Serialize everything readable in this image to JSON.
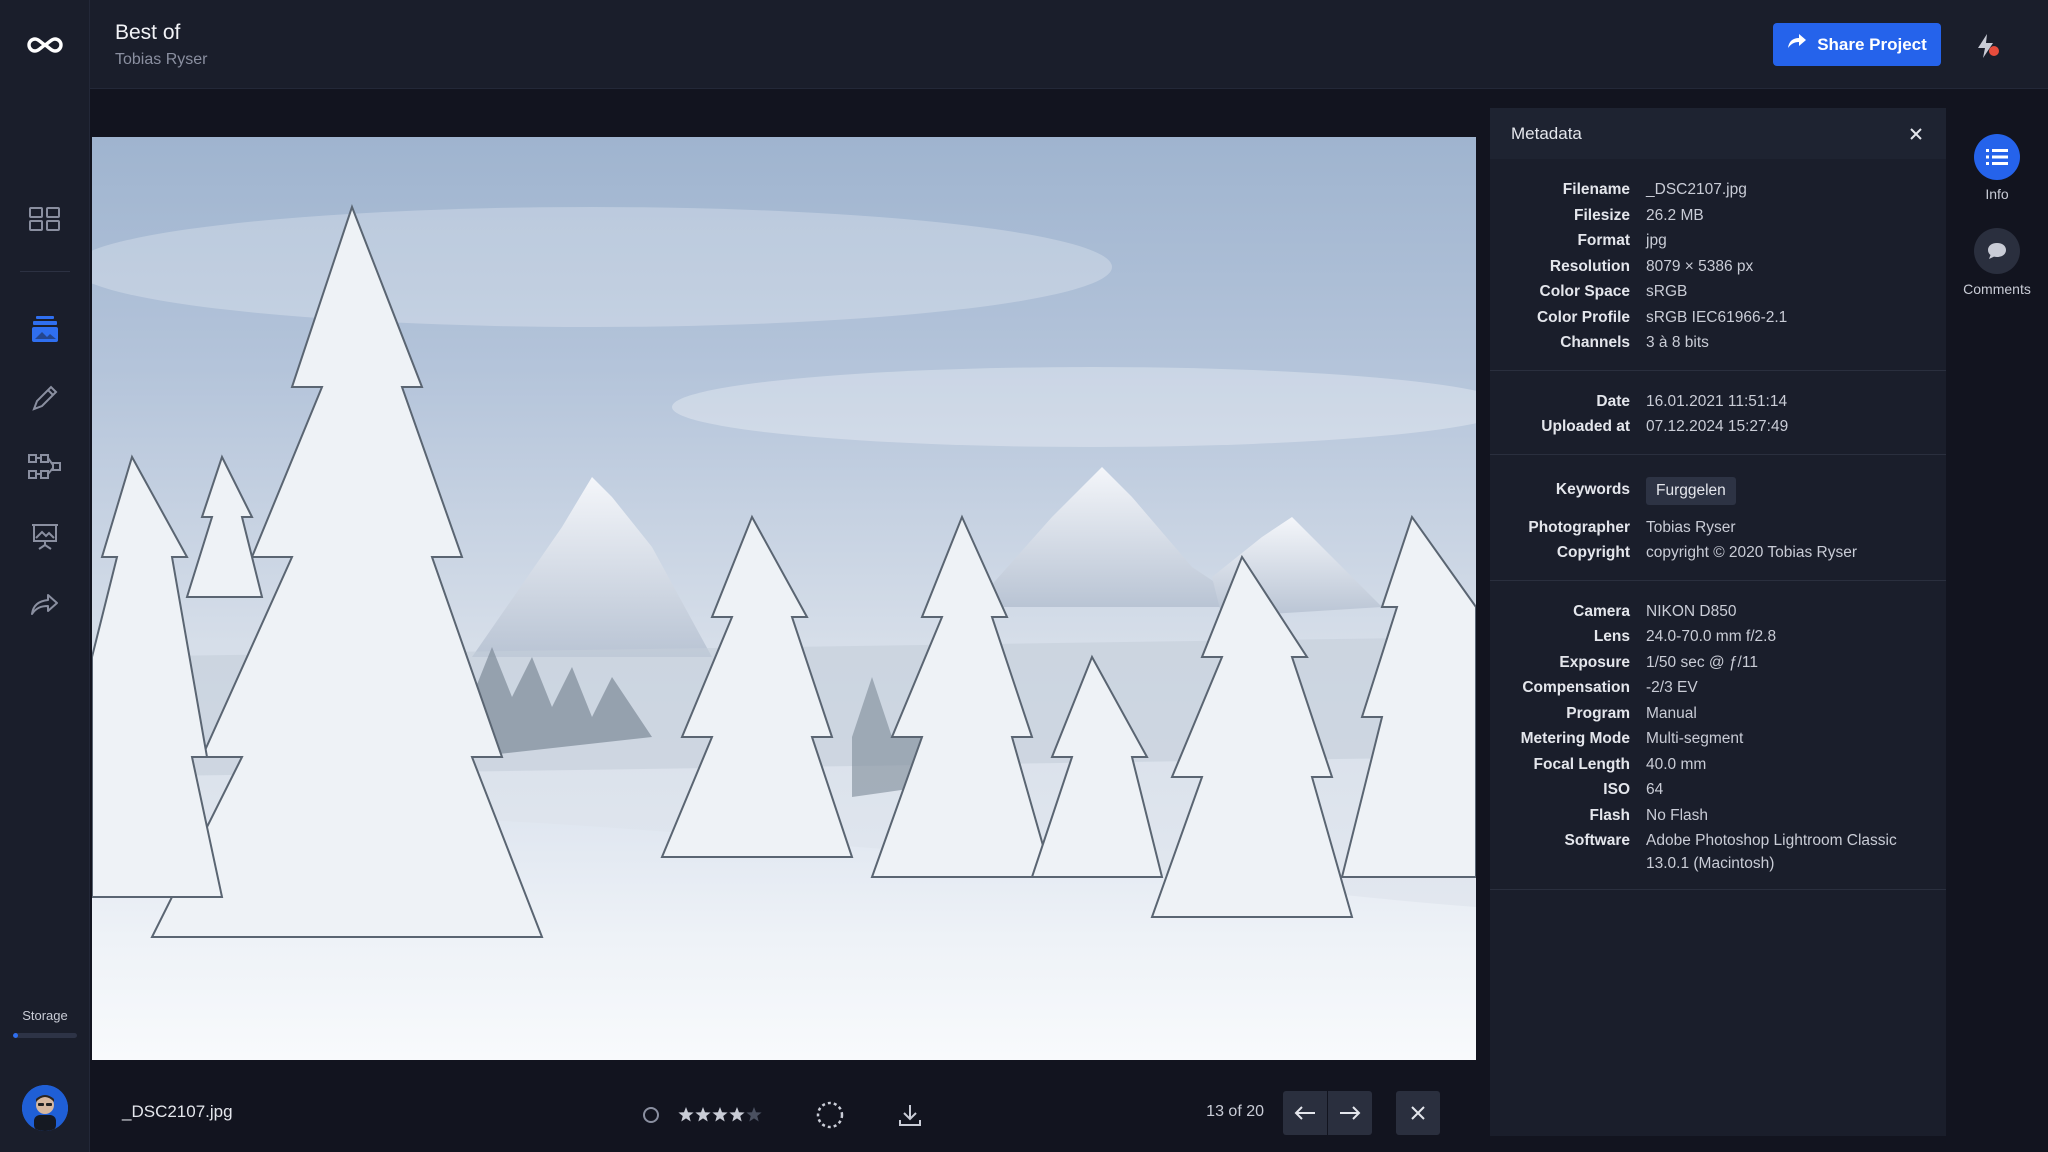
{
  "header": {
    "title": "Best of",
    "subtitle": "Tobias Ryser",
    "share_label": "Share Project"
  },
  "sidebar": {
    "items": [
      {
        "icon": "grid-icon"
      },
      {
        "icon": "gallery-icon",
        "active": true
      },
      {
        "icon": "pen-icon"
      },
      {
        "icon": "workflow-icon"
      },
      {
        "icon": "presentation-icon"
      },
      {
        "icon": "share-icon"
      }
    ],
    "storage_label": "Storage",
    "storage_fraction": 0.08
  },
  "viewer": {
    "filename": "_DSC2107.jpg",
    "rating": 4,
    "rating_max": 5,
    "counter": "13 of 20"
  },
  "metadata": {
    "title": "Metadata",
    "file": [
      {
        "label": "Filename",
        "value": "_DSC2107.jpg"
      },
      {
        "label": "Filesize",
        "value": "26.2 MB"
      },
      {
        "label": "Format",
        "value": "jpg"
      },
      {
        "label": "Resolution",
        "value": "8079 × 5386 px"
      },
      {
        "label": "Color Space",
        "value": "sRGB"
      },
      {
        "label": "Color Profile",
        "value": "sRGB IEC61966-2.1"
      },
      {
        "label": "Channels",
        "value": "3 à 8 bits"
      }
    ],
    "dates": [
      {
        "label": "Date",
        "value": "16.01.2021 11:51:14"
      },
      {
        "label": "Uploaded at",
        "value": "07.12.2024 15:27:49"
      }
    ],
    "keywords_label": "Keywords",
    "keywords": [
      "Furggelen"
    ],
    "credits": [
      {
        "label": "Photographer",
        "value": "Tobias Ryser"
      },
      {
        "label": "Copyright",
        "value": "copyright © 2020 Tobias Ryser"
      }
    ],
    "camera": [
      {
        "label": "Camera",
        "value": "NIKON D850"
      },
      {
        "label": "Lens",
        "value": "24.0-70.0 mm f/2.8"
      },
      {
        "label": "Exposure",
        "value": "1/50 sec @ ƒ/11"
      },
      {
        "label": "Compensation",
        "value": "-2/3 EV"
      },
      {
        "label": "Program",
        "value": "Manual"
      },
      {
        "label": "Metering Mode",
        "value": "Multi-segment"
      },
      {
        "label": "Focal Length",
        "value": "40.0 mm"
      },
      {
        "label": "ISO",
        "value": "64"
      },
      {
        "label": "Flash",
        "value": "No Flash"
      },
      {
        "label": "Software",
        "value": "Adobe Photoshop Lightroom Classic 13.0.1 (Macintosh)"
      }
    ]
  },
  "rail": {
    "info_label": "Info",
    "comments_label": "Comments"
  },
  "colors": {
    "accent": "#2563eb",
    "background": "#12141f",
    "panel": "#1a1e2b"
  }
}
